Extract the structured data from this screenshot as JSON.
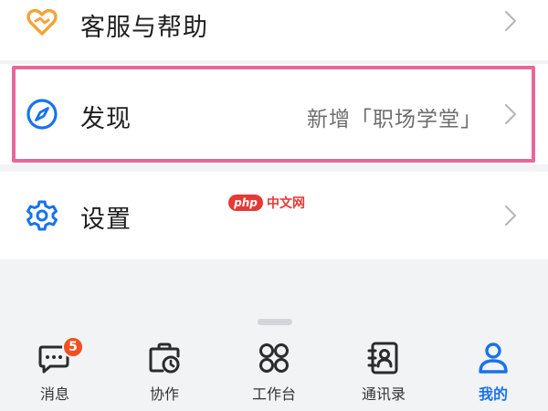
{
  "menu": {
    "help": {
      "label": "客服与帮助",
      "icon": "heart-handshake-icon",
      "icon_color": "#f2a33a"
    },
    "discover": {
      "label": "发现",
      "value": "新增「职场学堂」",
      "icon": "compass-icon",
      "icon_color": "#1a73e8"
    },
    "settings": {
      "label": "设置",
      "icon": "gear-icon",
      "icon_color": "#1a73e8"
    }
  },
  "highlight_color": "#e8679a",
  "watermark": {
    "badge": "php",
    "text": "中文网"
  },
  "tabbar": {
    "active": "me",
    "accent_color": "#1a73e8",
    "tabs": [
      {
        "id": "messages",
        "label": "消息",
        "icon": "chat-bubble-icon",
        "badge": "5"
      },
      {
        "id": "collab",
        "label": "协作",
        "icon": "briefcase-clock-icon"
      },
      {
        "id": "workbench",
        "label": "工作台",
        "icon": "grid-icon"
      },
      {
        "id": "contacts",
        "label": "通讯录",
        "icon": "contact-book-icon"
      },
      {
        "id": "me",
        "label": "我的",
        "icon": "person-icon"
      }
    ]
  }
}
